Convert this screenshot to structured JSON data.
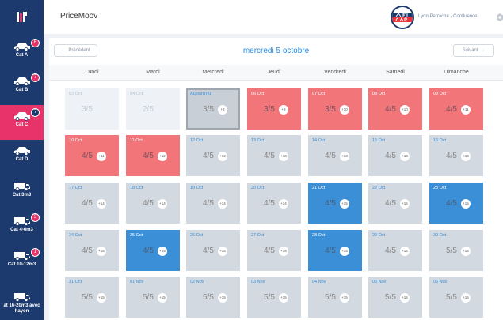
{
  "header": {
    "app_title": "PriceMoov",
    "agency": "Lyon Perrache · Confluence",
    "brand_logo_text": "RENT A CAR"
  },
  "sidebar": {
    "items": [
      {
        "label": "Cat A",
        "badge": "6"
      },
      {
        "label": "Cat B",
        "badge": "7"
      },
      {
        "label": "Cat C",
        "badge": "7",
        "active": true
      },
      {
        "label": "Cat D",
        "badge": ""
      },
      {
        "label": "Cat 3m3",
        "badge": ""
      },
      {
        "label": "Cat 4-6m3",
        "badge": "3"
      },
      {
        "label": "Cat 10-12m3",
        "badge": "1"
      },
      {
        "label": "at 16-20m3 avec hayon",
        "badge": ""
      }
    ]
  },
  "calendar": {
    "prev_label": "Précédent",
    "next_label": "Suivant",
    "current_date": "mercredi 5 octobre",
    "days": [
      "Lundi",
      "Mardi",
      "Mercredi",
      "Jeudi",
      "Vendredi",
      "Samedi",
      "Dimanche"
    ],
    "weeks": [
      [
        {
          "date": "03 Oct",
          "count": "3/5",
          "plus": "",
          "state": "past"
        },
        {
          "date": "04 Oct",
          "count": "2/5",
          "plus": "",
          "state": "past"
        },
        {
          "date": "Aujourd'hui",
          "count": "3/5",
          "plus": "+8",
          "state": "today"
        },
        {
          "date": "06 Oct",
          "count": "3/5",
          "plus": "+8",
          "state": "red"
        },
        {
          "date": "07 Oct",
          "count": "3/5",
          "plus": "+10",
          "state": "red"
        },
        {
          "date": "08 Oct",
          "count": "4/5",
          "plus": "+10",
          "state": "red"
        },
        {
          "date": "09 Oct",
          "count": "4/5",
          "plus": "+11",
          "state": "red"
        }
      ],
      [
        {
          "date": "10 Oct",
          "count": "4/5",
          "plus": "+11",
          "state": "red"
        },
        {
          "date": "11 Oct",
          "count": "4/5",
          "plus": "+12",
          "state": "red"
        },
        {
          "date": "12 Oct",
          "count": "4/5",
          "plus": "+12",
          "state": "normal"
        },
        {
          "date": "13 Oct",
          "count": "4/5",
          "plus": "+13",
          "state": "normal"
        },
        {
          "date": "14 Oct",
          "count": "4/5",
          "plus": "+13",
          "state": "normal"
        },
        {
          "date": "15 Oct",
          "count": "4/5",
          "plus": "+13",
          "state": "normal"
        },
        {
          "date": "16 Oct",
          "count": "4/5",
          "plus": "+13",
          "state": "normal"
        }
      ],
      [
        {
          "date": "17 Oct",
          "count": "4/5",
          "plus": "+14",
          "state": "normal"
        },
        {
          "date": "18 Oct",
          "count": "4/5",
          "plus": "+14",
          "state": "normal"
        },
        {
          "date": "19 Oct",
          "count": "4/5",
          "plus": "+14",
          "state": "normal"
        },
        {
          "date": "20 Oct",
          "count": "4/5",
          "plus": "+14",
          "state": "normal"
        },
        {
          "date": "21 Oct",
          "count": "4/5",
          "plus": "+15",
          "state": "blue"
        },
        {
          "date": "22 Oct",
          "count": "4/5",
          "plus": "+15",
          "state": "normal"
        },
        {
          "date": "23 Oct",
          "count": "4/5",
          "plus": "+15",
          "state": "blue"
        }
      ],
      [
        {
          "date": "24 Oct",
          "count": "4/5",
          "plus": "+15",
          "state": "normal"
        },
        {
          "date": "25 Oct",
          "count": "4/5",
          "plus": "+15",
          "state": "blue"
        },
        {
          "date": "26 Oct",
          "count": "4/5",
          "plus": "+15",
          "state": "normal"
        },
        {
          "date": "27 Oct",
          "count": "4/5",
          "plus": "+15",
          "state": "normal"
        },
        {
          "date": "28 Oct",
          "count": "4/5",
          "plus": "+15",
          "state": "blue"
        },
        {
          "date": "29 Oct",
          "count": "4/5",
          "plus": "+15",
          "state": "normal"
        },
        {
          "date": "30 Oct",
          "count": "5/5",
          "plus": "+15",
          "state": "normal"
        }
      ],
      [
        {
          "date": "31 Oct",
          "count": "5/5",
          "plus": "+15",
          "state": "normal"
        },
        {
          "date": "01 Nov",
          "count": "5/5",
          "plus": "+15",
          "state": "normal"
        },
        {
          "date": "02 Nov",
          "count": "5/5",
          "plus": "+15",
          "state": "normal"
        },
        {
          "date": "03 Nov",
          "count": "5/5",
          "plus": "+15",
          "state": "normal"
        },
        {
          "date": "04 Nov",
          "count": "5/5",
          "plus": "+15",
          "state": "normal"
        },
        {
          "date": "05 Nov",
          "count": "5/5",
          "plus": "+15",
          "state": "normal"
        },
        {
          "date": "06 Nov",
          "count": "5/5",
          "plus": "+15",
          "state": "normal"
        }
      ]
    ]
  },
  "colors": {
    "sidebar": "#1d3a6e",
    "accent": "#e8336a",
    "over": "#f2757a",
    "under": "#3a8fd6",
    "title": "#2a8de0"
  }
}
